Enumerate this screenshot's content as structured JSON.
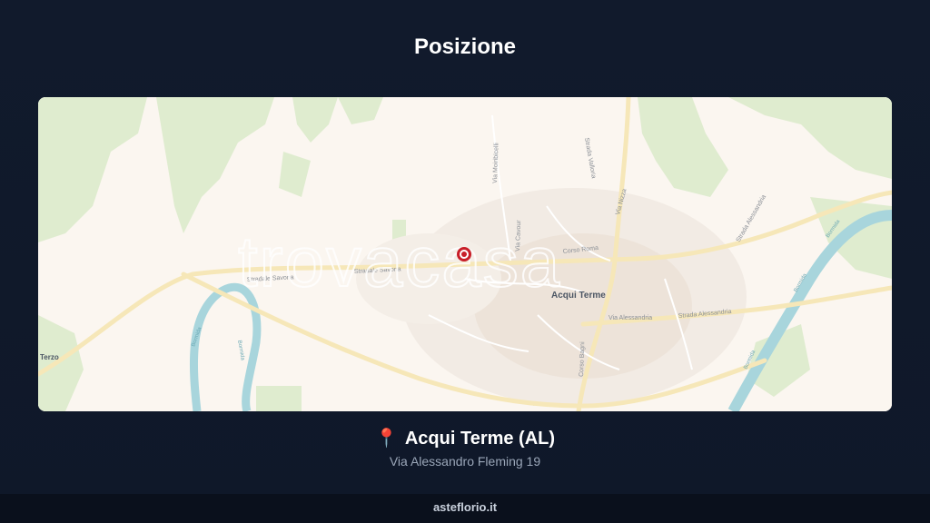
{
  "header": {
    "title": "Posizione"
  },
  "map": {
    "watermark": "trovacasa",
    "labels": {
      "city": "Acqui Terme",
      "terzo": "Terzo",
      "stradale_savona_1": "Stradale Savona",
      "stradale_savona_2": "Stradale Savona",
      "corso_roma": "Corso Roma",
      "via_alessandria": "Via Alessandria",
      "strada_alessandria_1": "Strada Alessandria",
      "strada_alessandria_2": "Strada Alessandria",
      "via_nizza": "Via Nizza",
      "corso_bagni": "Corso Bagni",
      "via_moiribicelli": "Via Moiribicelli",
      "via_cavour": "Via Cavour",
      "strada_valloria": "Strada Valloria",
      "bormida_1": "Bormida",
      "bormida_2": "Bormida",
      "bormida_3": "Bormida",
      "bormida_4": "Bormida",
      "bormida_5": "Bormida"
    }
  },
  "location": {
    "pin_icon": "📍",
    "city": "Acqui Terme (AL)",
    "address": "Via Alessandro Fleming 19"
  },
  "footer": {
    "site": "asteflorio.it"
  }
}
